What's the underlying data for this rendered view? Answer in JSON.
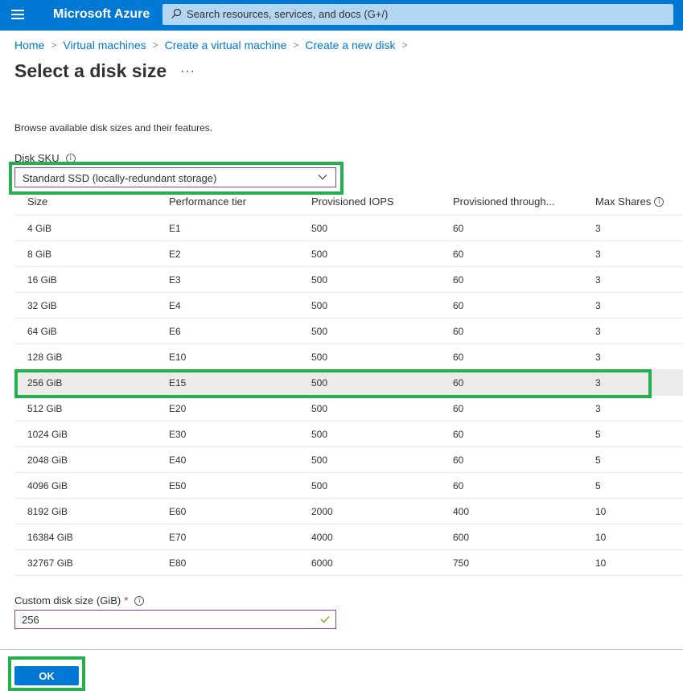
{
  "topbar": {
    "brand": "Microsoft Azure",
    "search_placeholder": "Search resources, services, and docs (G+/)",
    "color": "#0078d4"
  },
  "breadcrumb": [
    {
      "label": "Home"
    },
    {
      "label": "Virtual machines"
    },
    {
      "label": "Create a virtual machine"
    },
    {
      "label": "Create a new disk"
    }
  ],
  "page": {
    "title": "Select a disk size",
    "more_label": "···",
    "description": "Browse available disk sizes and their features."
  },
  "sku": {
    "label": "Disk SKU",
    "value": "Standard SSD (locally-redundant storage)"
  },
  "table": {
    "columns": [
      "Size",
      "Performance tier",
      "Provisioned IOPS",
      "Provisioned through...",
      "Max Shares"
    ],
    "selected_index": 6,
    "rows": [
      [
        "4 GiB",
        "E1",
        "500",
        "60",
        "3"
      ],
      [
        "8 GiB",
        "E2",
        "500",
        "60",
        "3"
      ],
      [
        "16 GiB",
        "E3",
        "500",
        "60",
        "3"
      ],
      [
        "32 GiB",
        "E4",
        "500",
        "60",
        "3"
      ],
      [
        "64 GiB",
        "E6",
        "500",
        "60",
        "3"
      ],
      [
        "128 GiB",
        "E10",
        "500",
        "60",
        "3"
      ],
      [
        "256 GiB",
        "E15",
        "500",
        "60",
        "3"
      ],
      [
        "512 GiB",
        "E20",
        "500",
        "60",
        "3"
      ],
      [
        "1024 GiB",
        "E30",
        "500",
        "60",
        "5"
      ],
      [
        "2048 GiB",
        "E40",
        "500",
        "60",
        "5"
      ],
      [
        "4096 GiB",
        "E50",
        "500",
        "60",
        "5"
      ],
      [
        "8192 GiB",
        "E60",
        "2000",
        "400",
        "10"
      ],
      [
        "16384 GiB",
        "E70",
        "4000",
        "600",
        "10"
      ],
      [
        "32767 GiB",
        "E80",
        "6000",
        "750",
        "10"
      ]
    ]
  },
  "custom_size": {
    "label": "Custom disk size (GiB)",
    "required_mark": "*",
    "value": "256"
  },
  "footer": {
    "ok_label": "OK"
  },
  "highlight_color": "#22b14c"
}
